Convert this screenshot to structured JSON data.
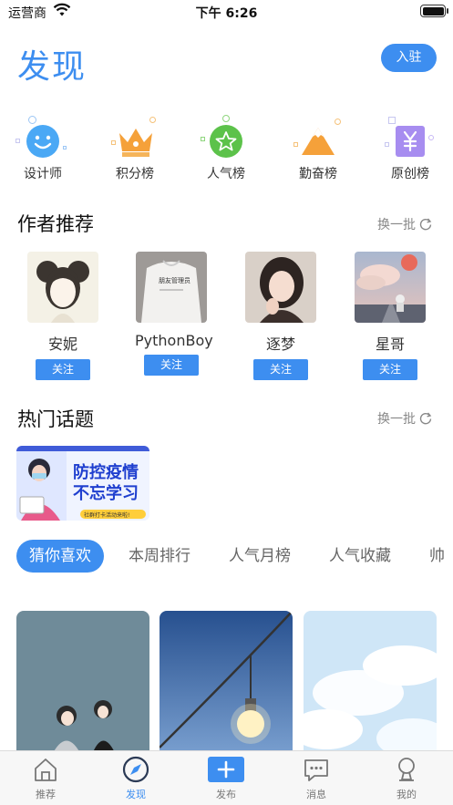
{
  "status_bar": {
    "carrier": "运营商",
    "time": "下午 6:26"
  },
  "header": {
    "title": "发现",
    "join_label": "入驻"
  },
  "categories": [
    {
      "label": "设计师",
      "icon": "smiley-icon",
      "color": "#4aa8f5"
    },
    {
      "label": "积分榜",
      "icon": "crown-icon",
      "color": "#f5a13a"
    },
    {
      "label": "人气榜",
      "icon": "star-icon",
      "color": "#5cc24a"
    },
    {
      "label": "勤奋榜",
      "icon": "mountain-icon",
      "color": "#f5a13a"
    },
    {
      "label": "原创榜",
      "icon": "yen-icon",
      "color": "#a78df0"
    }
  ],
  "authors_section": {
    "title": "作者推荐",
    "refresh_label": "换一批",
    "authors": [
      {
        "name": "安妮",
        "follow_label": "关注"
      },
      {
        "name": "PythonBoy",
        "follow_label": "关注",
        "shirt_text": "朋友管理员"
      },
      {
        "name": "逐梦",
        "follow_label": "关注"
      },
      {
        "name": "星哥",
        "follow_label": "关注"
      }
    ]
  },
  "topics_section": {
    "title": "热门话题",
    "refresh_label": "换一批",
    "topic": {
      "line1": "防控疫情",
      "line2": "不忘学习",
      "tag": "社群打卡活动来啦!"
    }
  },
  "tabs": [
    "猜你喜欢",
    "本周排行",
    "人气月榜",
    "人气收藏",
    "帅"
  ],
  "tab_bar": [
    {
      "label": "推荐",
      "icon": "home-icon"
    },
    {
      "label": "发现",
      "icon": "compass-icon"
    },
    {
      "label": "发布",
      "icon": "plus-icon"
    },
    {
      "label": "消息",
      "icon": "message-icon"
    },
    {
      "label": "我的",
      "icon": "user-icon"
    }
  ],
  "colors": {
    "accent": "#3d8ef0",
    "text": "#222222",
    "muted": "#888888"
  }
}
